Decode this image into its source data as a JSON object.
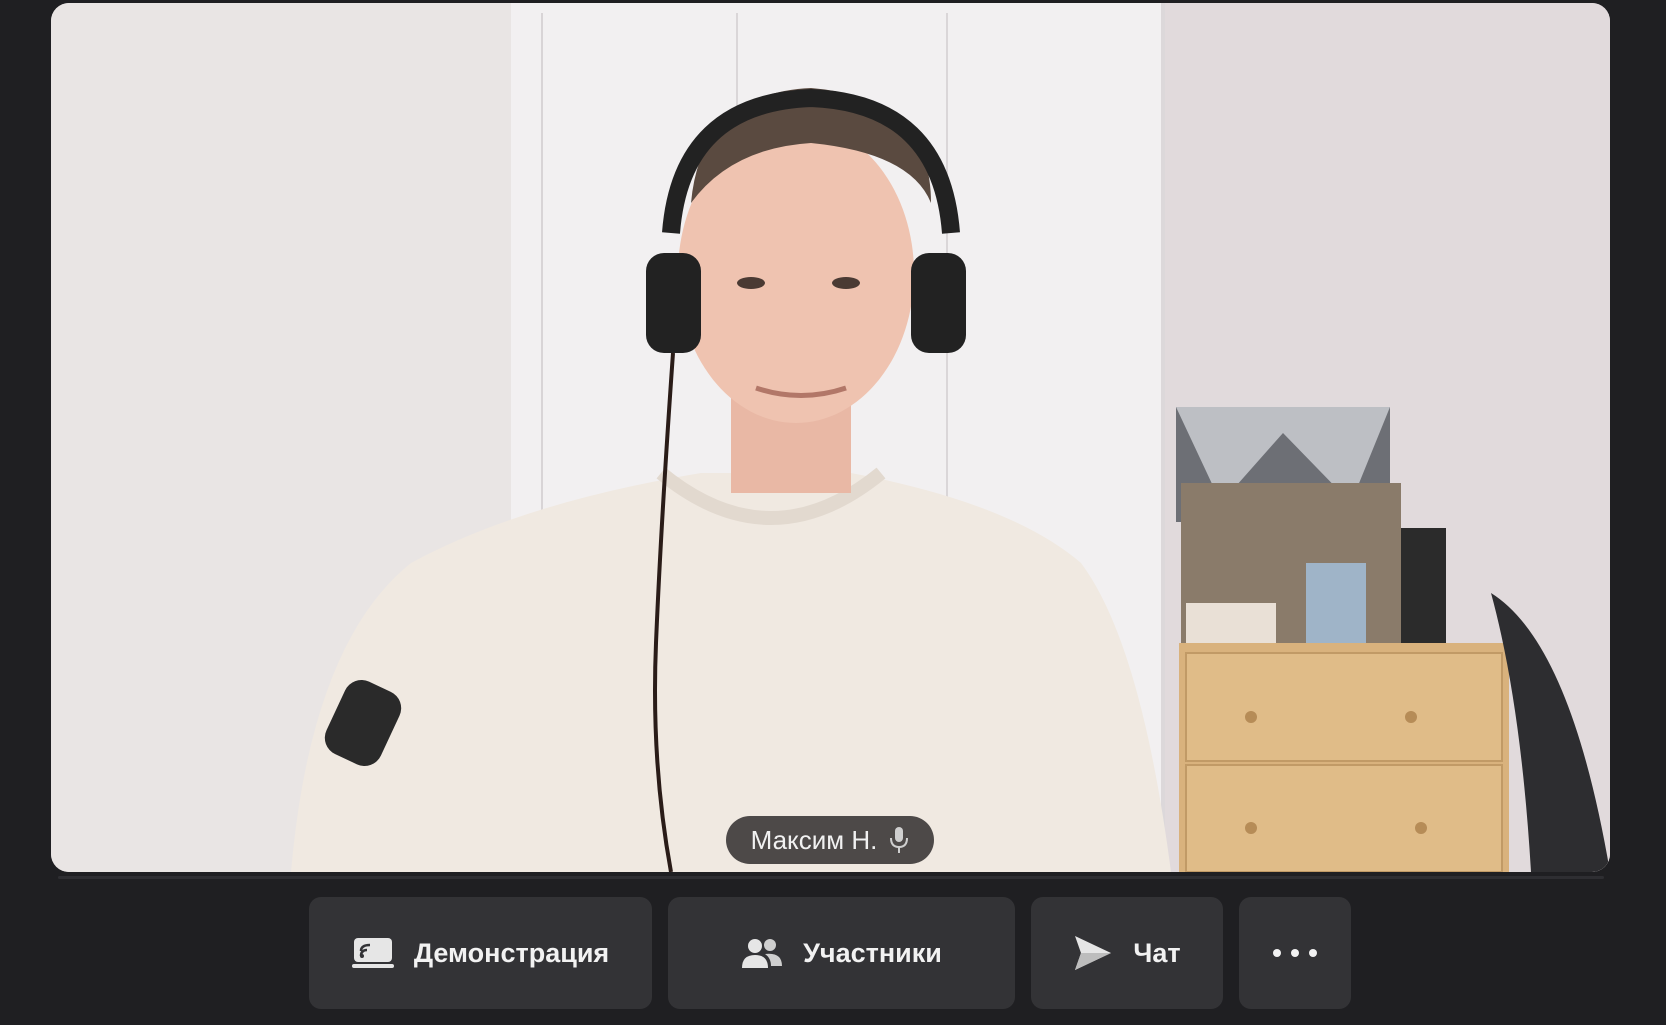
{
  "participant": {
    "name": "Максим Н.",
    "mic_icon": "microphone-icon"
  },
  "controls": {
    "demo_label": "Демонстрация",
    "demo_icon": "screen-share-icon",
    "people_label": "Участники",
    "people_icon": "participants-icon",
    "chat_label": "Чат",
    "chat_icon": "send-icon",
    "more_icon": "more-dots-icon"
  },
  "colors": {
    "background": "#1f1f22",
    "button": "#333336",
    "text": "#f2f2f2"
  }
}
